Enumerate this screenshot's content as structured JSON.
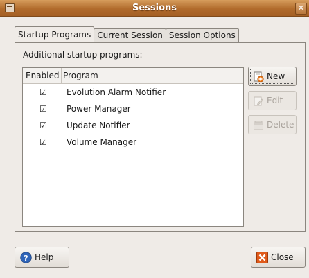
{
  "window": {
    "title": "Sessions"
  },
  "tabs": [
    {
      "label": "Startup Programs",
      "active": true
    },
    {
      "label": "Current Session",
      "active": false
    },
    {
      "label": "Session Options",
      "active": false
    }
  ],
  "startup": {
    "section_label": "Additional startup programs:",
    "columns": {
      "enabled": "Enabled",
      "program": "Program"
    },
    "rows": [
      {
        "enabled": true,
        "check_glyph": "☑",
        "program": "Evolution Alarm Notifier"
      },
      {
        "enabled": true,
        "check_glyph": "☑",
        "program": "Power Manager"
      },
      {
        "enabled": true,
        "check_glyph": "☑",
        "program": "Update Notifier"
      },
      {
        "enabled": true,
        "check_glyph": "☑",
        "program": "Volume Manager"
      }
    ]
  },
  "actions": {
    "new": {
      "label": "New",
      "enabled": true
    },
    "edit": {
      "label": "Edit",
      "enabled": false
    },
    "delete": {
      "label": "Delete",
      "enabled": false
    }
  },
  "footer": {
    "help": "Help",
    "close": "Close"
  },
  "colors": {
    "titlebar": "#b16b2c",
    "help_icon": "#2f64b8",
    "close_icon": "#e05a1a",
    "new_icon_accent": "#f07d1a"
  },
  "icons": {
    "new": "document-new-icon",
    "edit": "edit-icon",
    "delete": "delete-icon",
    "help": "help-icon",
    "close": "close-icon"
  }
}
